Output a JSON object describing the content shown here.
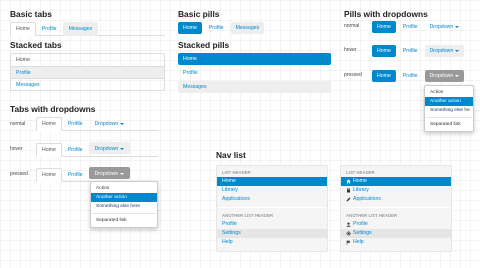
{
  "sections": {
    "basic_tabs": "Basic tabs",
    "basic_pills": "Basic pills",
    "pills_with_dropdowns": "Pills with dropdowns",
    "stacked_tabs": "Stacked tabs",
    "stacked_pills": "Stacked pills",
    "tabs_with_dropdowns": "Tabs with dropdowns",
    "nav_list": "Nav list"
  },
  "states": {
    "normal": "normal",
    "hover": "hover",
    "pressed": "pressed"
  },
  "nav": {
    "home": "Home",
    "profile": "Profile",
    "messages": "Messages",
    "dropdown": "Dropdown"
  },
  "dropdown_menu": {
    "action": "Action",
    "another_action": "Another action",
    "something_else": "Something else here",
    "something_else_truncated": "Something else he",
    "separated_link": "Separated link"
  },
  "navlist": {
    "list_header": "LIST HEADER",
    "another_list_header": "ANOTHER LIST HEADER",
    "home": "Home",
    "library": "Library",
    "applications": "Applications",
    "profile": "Profile",
    "settings": "Settings",
    "help": "Help"
  },
  "colors": {
    "accent": "#0088cc",
    "link": "#0088cc",
    "pressed": "#999999",
    "hover": "#eeeeee"
  },
  "icons": [
    "home-icon",
    "book-icon",
    "pencil-icon",
    "user-icon",
    "gear-icon",
    "flag-icon"
  ]
}
